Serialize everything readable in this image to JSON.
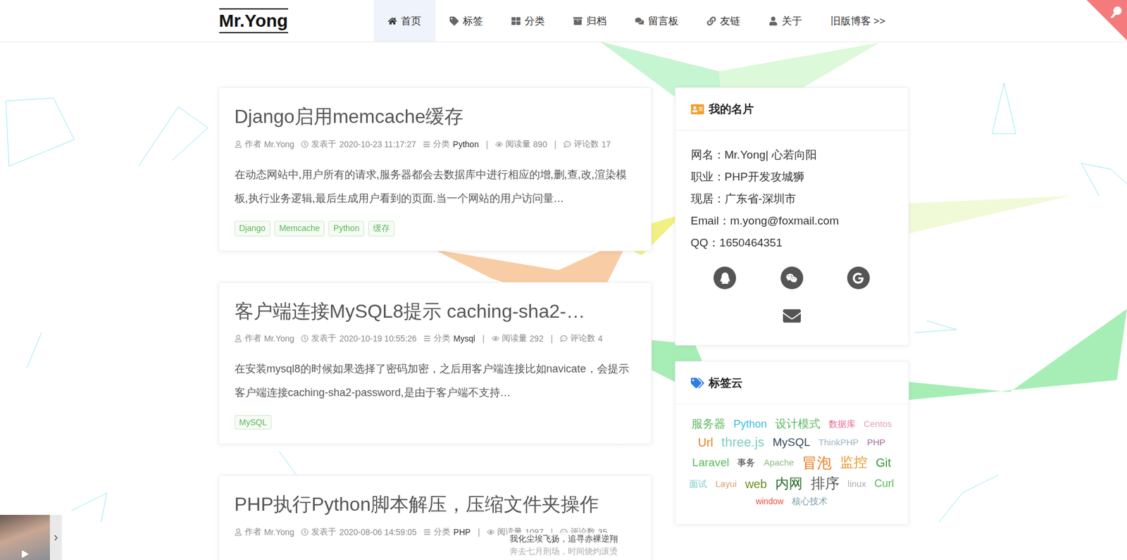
{
  "site": {
    "logo": "Mr.Yong"
  },
  "nav": [
    {
      "label": "首页",
      "selected": true
    },
    {
      "label": "标签",
      "selected": false
    },
    {
      "label": "分类",
      "selected": false
    },
    {
      "label": "归档",
      "selected": false
    },
    {
      "label": "留言板",
      "selected": false
    },
    {
      "label": "友链",
      "selected": false
    },
    {
      "label": "关于",
      "selected": false
    },
    {
      "label": "旧版博客 >>",
      "selected": false
    }
  ],
  "meta_labels": {
    "author": "作者",
    "date": "发表于",
    "category": "分类",
    "views": "阅读量",
    "comments": "评论数",
    "separator": "|"
  },
  "posts": [
    {
      "title": "Django启用memcache缓存",
      "author": "Mr.Yong",
      "date": "2020-10-23 11:17:27",
      "category": "Python",
      "views": "890",
      "comments": "17",
      "excerpt": "在动态网站中,用户所有的请求,服务器都会去数据库中进行相应的增,删,查,改,渲染模板,执行业务逻辑,最后生成用户看到的页面.当一个网站的用户访问量…",
      "tags": [
        "Django",
        "Memcache",
        "Python",
        "缓存"
      ]
    },
    {
      "title": "客户端连接MySQL8提示 caching-sha2-…",
      "author": "Mr.Yong",
      "date": "2020-10-19 10:55:26",
      "category": "Mysql",
      "views": "292",
      "comments": "4",
      "excerpt": "在安装mysql8的时候如果选择了密码加密，之后用客户端连接比如navicate，会提示客户端连接caching-sha2-password,是由于客户端不支持…",
      "tags": [
        "MySQL"
      ]
    },
    {
      "title": "PHP执行Python脚本解压，压缩文件夹操作",
      "author": "Mr.Yong",
      "date": "2020-08-06 14:59:05",
      "category": "PHP",
      "views": "1097",
      "comments": "35",
      "excerpt": "",
      "tags": []
    }
  ],
  "profile": {
    "title": "我的名片",
    "rows": [
      {
        "label": "网名：",
        "value": "Mr.Yong| 心若向阳"
      },
      {
        "label": "职业：",
        "value": "PHP开发攻城狮"
      },
      {
        "label": "现居：",
        "value": "广东省-深圳市"
      },
      {
        "label": "Email：",
        "value": "m.yong@foxmail.com"
      },
      {
        "label": "QQ：",
        "value": "1650464351"
      }
    ]
  },
  "tag_cloud": {
    "title": "标签云",
    "tags": [
      {
        "label": "服务器",
        "level": 0.35,
        "color": "#5cb85c"
      },
      {
        "label": "Python",
        "level": 0.3,
        "color": "#3bbfd8"
      },
      {
        "label": "设计模式",
        "level": 0.35,
        "color": "#5cb85c"
      },
      {
        "label": "数据库",
        "level": 0.15,
        "color": "#e26a8d"
      },
      {
        "label": "Centos",
        "level": 0.15,
        "color": "#e8a0b8"
      },
      {
        "label": "Url",
        "level": 0.45,
        "color": "#e67e22"
      },
      {
        "label": "three.js",
        "level": 0.55,
        "color": "#7fcfbf"
      },
      {
        "label": "MySQL",
        "level": 0.4,
        "color": "#34495e"
      },
      {
        "label": "ThinkPHP",
        "level": 0.15,
        "color": "#9fb4c2"
      },
      {
        "label": "PHP",
        "level": 0.15,
        "color": "#a0709e"
      },
      {
        "label": "Laravel",
        "level": 0.35,
        "color": "#5cb85c"
      },
      {
        "label": "事务",
        "level": 0.1,
        "color": "#333333"
      },
      {
        "label": "Apache",
        "level": 0.15,
        "color": "#8fbf85"
      },
      {
        "label": "冒泡",
        "level": 0.75,
        "color": "#e67e22"
      },
      {
        "label": "监控",
        "level": 0.65,
        "color": "#e89a30"
      },
      {
        "label": "Git",
        "level": 0.45,
        "color": "#3a9a3a"
      },
      {
        "label": "面试",
        "level": 0.1,
        "color": "#7cc7c7"
      },
      {
        "label": "Layui",
        "level": 0.15,
        "color": "#d9a070"
      },
      {
        "label": "web",
        "level": 0.45,
        "color": "#6b8e23"
      },
      {
        "label": "内网",
        "level": 0.65,
        "color": "#2c6e2c"
      },
      {
        "label": "排序",
        "level": 0.7,
        "color": "#555555"
      },
      {
        "label": "linux",
        "level": 0.1,
        "color": "#aaaaaa"
      },
      {
        "label": "Curl",
        "level": 0.3,
        "color": "#5cb85c"
      },
      {
        "label": "window",
        "level": 0.05,
        "color": "#e74c3c"
      },
      {
        "label": "核心技术",
        "level": 0.1,
        "color": "#7a9aaa"
      }
    ]
  },
  "player": {
    "arrow": "›"
  },
  "lyrics": [
    "我化尘埃飞扬，追寻赤裸逆翔",
    "奔去七月刑场，时间烧灼滚烫"
  ]
}
